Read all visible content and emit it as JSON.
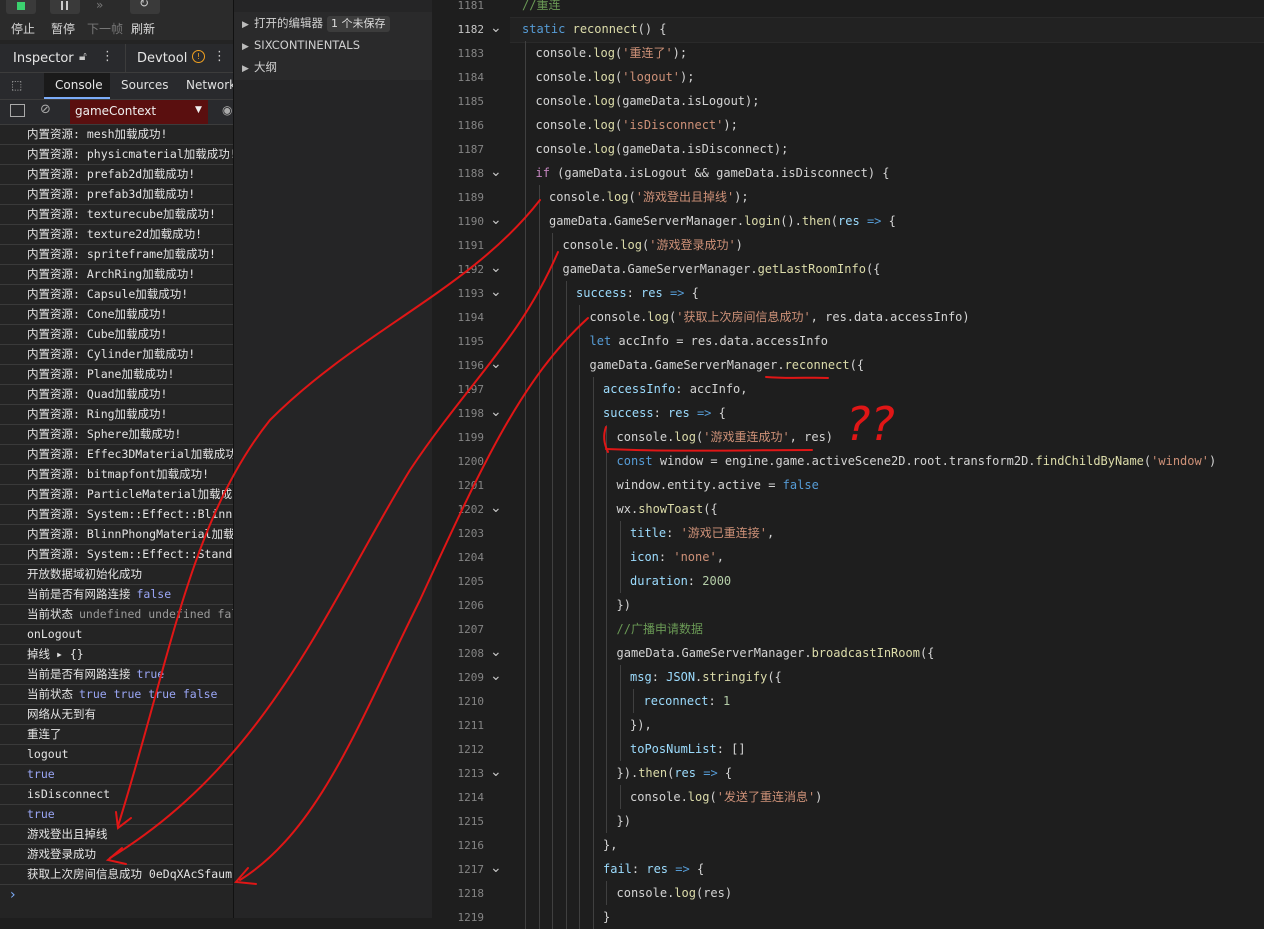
{
  "devtools": {
    "toolbar": {
      "stop": "停止",
      "pause": "暂停",
      "next_frame": "下一帧",
      "refresh": "刷新"
    },
    "tabs_top": {
      "inspector": "Inspector",
      "devtool": "Devtool"
    },
    "tabs": {
      "console": "Console",
      "sources": "Sources",
      "network": "Network"
    },
    "context": "gameContext",
    "console_lines": [
      {
        "text": "内置资源: mesh加载成功!"
      },
      {
        "text": "内置资源: physicmaterial加载成功!"
      },
      {
        "text": "内置资源: prefab2d加载成功!"
      },
      {
        "text": "内置资源: prefab3d加载成功!"
      },
      {
        "text": "内置资源: texturecube加载成功!"
      },
      {
        "text": "内置资源: texture2d加载成功!"
      },
      {
        "text": "内置资源: spriteframe加载成功!"
      },
      {
        "text": "内置资源: ArchRing加载成功!"
      },
      {
        "text": "内置资源: Capsule加载成功!"
      },
      {
        "text": "内置资源: Cone加载成功!"
      },
      {
        "text": "内置资源: Cube加载成功!"
      },
      {
        "text": "内置资源: Cylinder加载成功!"
      },
      {
        "text": "内置资源: Plane加载成功!"
      },
      {
        "text": "内置资源: Quad加载成功!"
      },
      {
        "text": "内置资源: Ring加载成功!"
      },
      {
        "text": "内置资源: Sphere加载成功!"
      },
      {
        "text": "内置资源: Effec3DMaterial加载成功"
      },
      {
        "text": "内置资源: bitmapfont加载成功!"
      },
      {
        "text": "内置资源: ParticleMaterial加载成"
      },
      {
        "text": "内置资源: System::Effect::BlinnP"
      },
      {
        "text": "内置资源: BlinnPhongMaterial加载成"
      },
      {
        "text": "内置资源: System::Effect::Standa"
      },
      {
        "text": "开放数据域初始化成功"
      },
      {
        "text": "当前是否有网路连接",
        "value": "false",
        "value_style": "blue"
      },
      {
        "text": "当前状态",
        "value": "undefined undefined fal",
        "value_style": "grey"
      },
      {
        "text": "onLogout"
      },
      {
        "text": "掉线",
        "value": "▸ {}",
        "value_style": "plain"
      },
      {
        "text": "当前是否有网路连接",
        "value": "true",
        "value_style": "blue"
      },
      {
        "text": "当前状态",
        "value": "true true true false",
        "value_style": "blue"
      },
      {
        "text": "网络从无到有"
      },
      {
        "text": "重连了"
      },
      {
        "text": "logout"
      },
      {
        "text": "",
        "value": "true",
        "value_style": "blue"
      },
      {
        "text": "isDisconnect"
      },
      {
        "text": "",
        "value": "true",
        "value_style": "blue"
      },
      {
        "text": "游戏登出且掉线"
      },
      {
        "text": "游戏登录成功"
      },
      {
        "text": "获取上次房间信息成功 0eDqXAcSfaum"
      }
    ],
    "prompt": "›"
  },
  "explorer": {
    "items": [
      {
        "label": "打开的编辑器",
        "badge": "1 个未保存"
      },
      {
        "label": "SIXCONTINENTALS",
        "badge": ""
      },
      {
        "label": "大纲",
        "badge": ""
      }
    ]
  },
  "editor": {
    "lines": [
      {
        "n": "1181",
        "html": "<span class=\"cmt\">//重连</span>",
        "indent": 0,
        "fold": false
      },
      {
        "n": "1182",
        "html": "<span class=\"kw\">static</span> <span class=\"fn\">reconnect</span>() {",
        "indent": 0,
        "fold": true,
        "active": true
      },
      {
        "n": "1183",
        "html": "console.<span class=\"fn\">log</span>(<span class=\"str\">'重连了'</span>);",
        "indent": 1,
        "fold": false
      },
      {
        "n": "1184",
        "html": "console.<span class=\"fn\">log</span>(<span class=\"str\">'logout'</span>);",
        "indent": 1,
        "fold": false
      },
      {
        "n": "1185",
        "html": "console.<span class=\"fn\">log</span>(gameData.isLogout);",
        "indent": 1,
        "fold": false
      },
      {
        "n": "1186",
        "html": "console.<span class=\"fn\">log</span>(<span class=\"str\">'isDisconnect'</span>);",
        "indent": 1,
        "fold": false
      },
      {
        "n": "1187",
        "html": "console.<span class=\"fn\">log</span>(gameData.isDisconnect);",
        "indent": 1,
        "fold": false
      },
      {
        "n": "1188",
        "html": "<span class=\"ctl\">if</span> (gameData.isLogout &amp;&amp; gameData.isDisconnect) {",
        "indent": 1,
        "fold": true
      },
      {
        "n": "1189",
        "html": "console.<span class=\"fn\">log</span>(<span class=\"str\">'游戏登出且掉线'</span>);",
        "indent": 2,
        "fold": false
      },
      {
        "n": "1190",
        "html": "gameData.GameServerManager.<span class=\"fn\">login</span>().<span class=\"fn\">then</span>(<span class=\"prop\">res</span> <span class=\"kw\">=&gt;</span> {",
        "indent": 2,
        "fold": true
      },
      {
        "n": "1191",
        "html": "console.<span class=\"fn\">log</span>(<span class=\"str\">'游戏登录成功'</span>)",
        "indent": 3,
        "fold": false
      },
      {
        "n": "1192",
        "html": "gameData.GameServerManager.<span class=\"fn\">getLastRoomInfo</span>({",
        "indent": 3,
        "fold": true
      },
      {
        "n": "1193",
        "html": "<span class=\"prop\">success</span>: <span class=\"prop\">res</span> <span class=\"kw\">=&gt;</span> {",
        "indent": 4,
        "fold": true
      },
      {
        "n": "1194",
        "html": "console.<span class=\"fn\">log</span>(<span class=\"str\">'获取上次房间信息成功'</span>, res.data.accessInfo)",
        "indent": 5,
        "fold": false
      },
      {
        "n": "1195",
        "html": "<span class=\"kw\">let</span> accInfo = res.data.accessInfo",
        "indent": 5,
        "fold": false
      },
      {
        "n": "1196",
        "html": "gameData.GameServerManager.<span class=\"fn\">reconnect</span>({",
        "indent": 5,
        "fold": true
      },
      {
        "n": "1197",
        "html": "<span class=\"prop\">accessInfo</span>: accInfo,",
        "indent": 6,
        "fold": false
      },
      {
        "n": "1198",
        "html": "<span class=\"prop\">success</span>: <span class=\"prop\">res</span> <span class=\"kw\">=&gt;</span> {",
        "indent": 6,
        "fold": true
      },
      {
        "n": "1199",
        "html": "console.<span class=\"fn\">log</span>(<span class=\"str\">'游戏重连成功'</span>, res)",
        "indent": 7,
        "fold": false
      },
      {
        "n": "1200",
        "html": "<span class=\"kw\">const</span> window = engine.game.activeScene2D.root.transform2D.<span class=\"fn\">findChildByName</span>(<span class=\"str\">'window'</span>)",
        "indent": 7,
        "fold": false
      },
      {
        "n": "1201",
        "html": "window.entity.active = <span class=\"kw\">false</span>",
        "indent": 7,
        "fold": false
      },
      {
        "n": "1202",
        "html": "wx.<span class=\"fn\">showToast</span>({",
        "indent": 7,
        "fold": true
      },
      {
        "n": "1203",
        "html": "<span class=\"prop\">title</span>: <span class=\"str\">'游戏已重连接'</span>,",
        "indent": 8,
        "fold": false
      },
      {
        "n": "1204",
        "html": "<span class=\"prop\">icon</span>: <span class=\"str\">'none'</span>,",
        "indent": 8,
        "fold": false
      },
      {
        "n": "1205",
        "html": "<span class=\"prop\">duration</span>: <span class=\"num\">2000</span>",
        "indent": 8,
        "fold": false
      },
      {
        "n": "1206",
        "html": "})",
        "indent": 7,
        "fold": false
      },
      {
        "n": "1207",
        "html": "<span class=\"cmt\">//广播申请数据</span>",
        "indent": 7,
        "fold": false
      },
      {
        "n": "1208",
        "html": "gameData.GameServerManager.<span class=\"fn\">broadcastInRoom</span>({",
        "indent": 7,
        "fold": true
      },
      {
        "n": "1209",
        "html": "<span class=\"prop\">msg</span>: <span class=\"prop\">JSON</span>.<span class=\"fn\">stringify</span>({",
        "indent": 8,
        "fold": true
      },
      {
        "n": "1210",
        "html": "<span class=\"prop\">reconnect</span>: <span class=\"num\">1</span>",
        "indent": 9,
        "fold": false
      },
      {
        "n": "1211",
        "html": "}),",
        "indent": 8,
        "fold": false
      },
      {
        "n": "1212",
        "html": "<span class=\"prop\">toPosNumList</span>: []",
        "indent": 8,
        "fold": false
      },
      {
        "n": "1213",
        "html": "}).<span class=\"fn\">then</span>(<span class=\"prop\">res</span> <span class=\"kw\">=&gt;</span> {",
        "indent": 7,
        "fold": true
      },
      {
        "n": "1214",
        "html": "console.<span class=\"fn\">log</span>(<span class=\"str\">'发送了重连消息'</span>)",
        "indent": 8,
        "fold": false
      },
      {
        "n": "1215",
        "html": "})",
        "indent": 7,
        "fold": false
      },
      {
        "n": "1216",
        "html": "},",
        "indent": 6,
        "fold": false
      },
      {
        "n": "1217",
        "html": "<span class=\"prop\">fail</span>: <span class=\"prop\">res</span> <span class=\"kw\">=&gt;</span> {",
        "indent": 6,
        "fold": true
      },
      {
        "n": "1218",
        "html": "console.<span class=\"fn\">log</span>(res)",
        "indent": 7,
        "fold": false
      },
      {
        "n": "1219",
        "html": "}",
        "indent": 6,
        "fold": false
      }
    ],
    "annotation_text": "??"
  },
  "colors": {
    "annotation": "#e01616",
    "console_value": "#9aa6f5",
    "string": "#ce9178"
  }
}
